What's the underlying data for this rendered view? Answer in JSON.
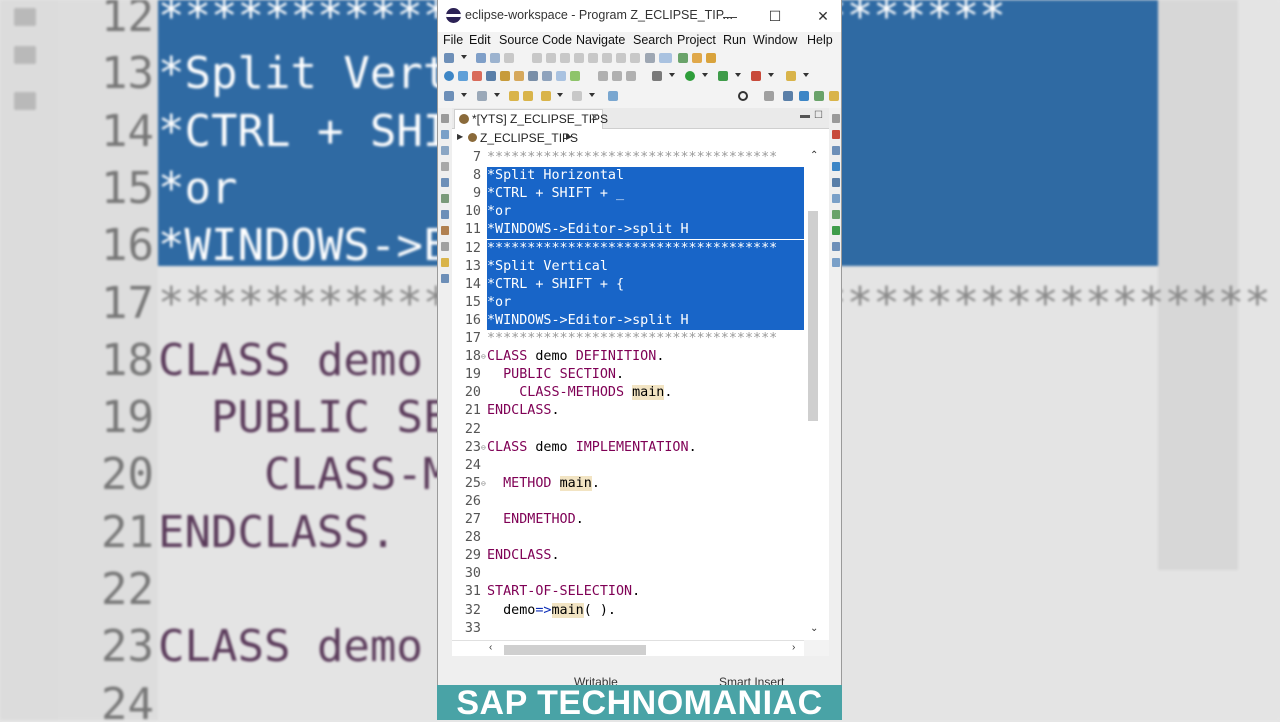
{
  "window": {
    "title": "eclipse-workspace - Program Z_ECLIPSE_TIP...",
    "min_glyph": "—",
    "max_glyph": "☐",
    "close_glyph": "✕"
  },
  "menu": [
    "File",
    "Edit",
    "Source Code",
    "Navigate",
    "Search",
    "Project",
    "Run",
    "Window",
    "Help"
  ],
  "editor_tab": {
    "label": "*[YTS] Z_ECLIPSE_TIPS",
    "close": "✕"
  },
  "breadcrumb": {
    "label": "Z_ECLIPSE_TIPS"
  },
  "code": [
    {
      "num": "7",
      "text": "************************************",
      "sel": false,
      "fold": false
    },
    {
      "num": "8",
      "text": "*Split Horizontal",
      "sel": true,
      "fold": false
    },
    {
      "num": "9",
      "text": "*CTRL + SHIFT + _",
      "sel": true,
      "fold": false
    },
    {
      "num": "10",
      "text": "*or",
      "sel": true,
      "fold": false
    },
    {
      "num": "11",
      "text": "*WINDOWS->Editor->split H",
      "sel": true,
      "fold": false
    },
    {
      "num": "12",
      "text": "************************************",
      "sel": true,
      "fold": false
    },
    {
      "num": "13",
      "text": "*Split Vertical",
      "sel": true,
      "fold": false
    },
    {
      "num": "14",
      "text": "*CTRL + SHIFT + {",
      "sel": true,
      "fold": false
    },
    {
      "num": "15",
      "text": "*or",
      "sel": true,
      "fold": false
    },
    {
      "num": "16",
      "text": "*WINDOWS->Editor->split H",
      "sel": true,
      "fold": false
    },
    {
      "num": "17",
      "text": "************************************",
      "sel": false,
      "fold": false
    },
    {
      "num": "18",
      "text": "CLASS demo DEFINITION.",
      "sel": false,
      "fold": true
    },
    {
      "num": "19",
      "text": "  PUBLIC SECTION.",
      "sel": false,
      "fold": false
    },
    {
      "num": "20",
      "text": "    CLASS-METHODS main.",
      "sel": false,
      "fold": false
    },
    {
      "num": "21",
      "text": "ENDCLASS.",
      "sel": false,
      "fold": false
    },
    {
      "num": "22",
      "text": "",
      "sel": false,
      "fold": false
    },
    {
      "num": "23",
      "text": "CLASS demo IMPLEMENTATION.",
      "sel": false,
      "fold": true
    },
    {
      "num": "24",
      "text": "",
      "sel": false,
      "fold": false
    },
    {
      "num": "25",
      "text": "  METHOD main.",
      "sel": false,
      "fold": true
    },
    {
      "num": "26",
      "text": "",
      "sel": false,
      "fold": false
    },
    {
      "num": "27",
      "text": "  ENDMETHOD.",
      "sel": false,
      "fold": false
    },
    {
      "num": "28",
      "text": "",
      "sel": false,
      "fold": false
    },
    {
      "num": "29",
      "text": "ENDCLASS.",
      "sel": false,
      "fold": false
    },
    {
      "num": "30",
      "text": "",
      "sel": false,
      "fold": false
    },
    {
      "num": "31",
      "text": "START-OF-SELECTION.",
      "sel": false,
      "fold": false
    },
    {
      "num": "32",
      "text": "  demo=>main( ).",
      "sel": false,
      "fold": false
    },
    {
      "num": "33",
      "text": "",
      "sel": false,
      "fold": false
    }
  ],
  "status": {
    "writable": "Writable",
    "insert_mode": "Smart Insert"
  },
  "banner": "SAP TECHNOMANIAC",
  "background_zoom": [
    {
      "num": "12",
      "text": "********************************"
    },
    {
      "num": "13",
      "text": "*Split Vertical"
    },
    {
      "num": "14",
      "text": "*CTRL + SHIFT + {"
    },
    {
      "num": "15",
      "text": "*or"
    },
    {
      "num": "16",
      "text": "*WINDOWS->Editor->split H"
    },
    {
      "num": "17",
      "text": "******************************************"
    },
    {
      "num": "18",
      "text": "CLASS demo DEFINITION."
    },
    {
      "num": "19",
      "text": "  PUBLIC SECTION."
    },
    {
      "num": "20",
      "text": "    CLASS-METHODS main."
    },
    {
      "num": "21",
      "text": "ENDCLASS."
    },
    {
      "num": "22",
      "text": ""
    },
    {
      "num": "23",
      "text": "CLASS demo IMPLEMENTATION."
    },
    {
      "num": "24",
      "text": ""
    }
  ],
  "colors": {
    "selection": "#1865c8",
    "keyword": "#7f0055",
    "banner": "#49a3a6",
    "background_selection": "#2f6aa3"
  }
}
